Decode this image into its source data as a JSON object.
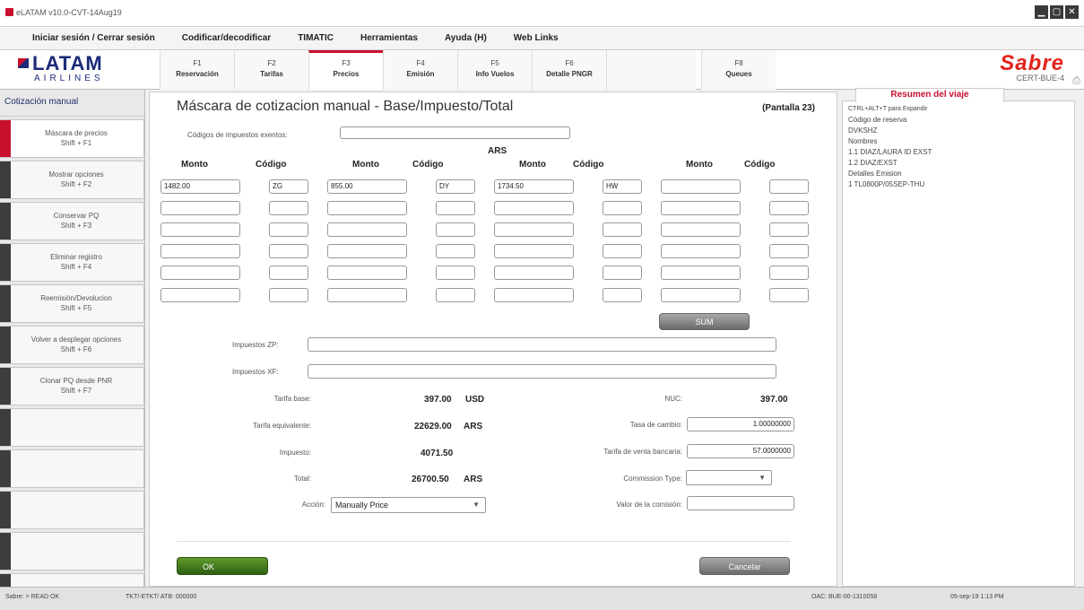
{
  "window": {
    "title": "eLATAM v10.0-CVT-14Aug19"
  },
  "menu": [
    "Iniciar sesión / Cerrar sesión",
    "Codificar/decodificar",
    "TIMATIC",
    "Herramientas",
    "Ayuda (H)",
    "Web Links"
  ],
  "brand": {
    "name": "LATAM",
    "sub": "AIRLINES",
    "sabre": "Sabre",
    "sabre_code": "CERT-BUE-4"
  },
  "fkeys": [
    {
      "key": "F1",
      "name": "Reservación"
    },
    {
      "key": "F2",
      "name": "Tarifas"
    },
    {
      "key": "F3",
      "name": "Precios",
      "active": true
    },
    {
      "key": "F4",
      "name": "Emisión"
    },
    {
      "key": "F5",
      "name": "Info Vuelos"
    },
    {
      "key": "F6",
      "name": "Detalle PNGR"
    },
    {
      "key": "",
      "name": ""
    },
    {
      "key": "F8",
      "name": "Queues"
    }
  ],
  "sidebar": {
    "header": "Cotización manual",
    "items": [
      {
        "label": "Máscara de precios",
        "key": "Shift + F1"
      },
      {
        "label": "Mostrar opciones",
        "key": "Shift + F2"
      },
      {
        "label": "Conservar PQ",
        "key": "Shift + F3"
      },
      {
        "label": "Eliminar registro",
        "key": "Shift + F4"
      },
      {
        "label": "Reemisión/Devolucion",
        "key": "Shift + F5"
      },
      {
        "label": "Volver a desplegar opciones",
        "key": "Shift + F6"
      },
      {
        "label": "Clonar PQ desde PNR",
        "key": "Shift + F7"
      }
    ]
  },
  "main": {
    "title": "Máscara de cotizacion manual - Base/Impuesto/Total",
    "pantalla": "(Pantalla 23)",
    "exempt_label": "Códigos de impuestos exentos:",
    "currency": "ARS",
    "col_monto": "Monto",
    "col_codigo": "Código",
    "tax_rows": [
      [
        {
          "monto": "1482.00",
          "codigo": "ZG"
        },
        {
          "monto": "855.00",
          "codigo": "DY"
        },
        {
          "monto": "1734.50",
          "codigo": "HW"
        },
        {
          "monto": "",
          "codigo": ""
        }
      ],
      [
        {
          "monto": "",
          "codigo": ""
        },
        {
          "monto": "",
          "codigo": ""
        },
        {
          "monto": "",
          "codigo": ""
        },
        {
          "monto": "",
          "codigo": ""
        }
      ],
      [
        {
          "monto": "",
          "codigo": ""
        },
        {
          "monto": "",
          "codigo": ""
        },
        {
          "monto": "",
          "codigo": ""
        },
        {
          "monto": "",
          "codigo": ""
        }
      ],
      [
        {
          "monto": "",
          "codigo": ""
        },
        {
          "monto": "",
          "codigo": ""
        },
        {
          "monto": "",
          "codigo": ""
        },
        {
          "monto": "",
          "codigo": ""
        }
      ],
      [
        {
          "monto": "",
          "codigo": ""
        },
        {
          "monto": "",
          "codigo": ""
        },
        {
          "monto": "",
          "codigo": ""
        },
        {
          "monto": "",
          "codigo": ""
        }
      ],
      [
        {
          "monto": "",
          "codigo": ""
        },
        {
          "monto": "",
          "codigo": ""
        },
        {
          "monto": "",
          "codigo": ""
        },
        {
          "monto": "",
          "codigo": ""
        }
      ]
    ],
    "sum_button": "SUM",
    "zp_label": "Impuestos ZP:",
    "xf_label": "Impuestos XF:",
    "tarifa_base_label": "Tarifa base:",
    "tarifa_base_value": "397.00",
    "tarifa_base_currency": "USD",
    "tarifa_equiv_label": "Tarifa equivalente:",
    "tarifa_equiv_value": "22629.00",
    "tarifa_equiv_currency": "ARS",
    "impuesto_label": "Impuesto:",
    "impuesto_value": "4071.50",
    "total_label": "Total:",
    "total_value": "26700.50",
    "total_currency": "ARS",
    "accion_label": "Acción:",
    "accion_value": "Manually Price",
    "nuc_label": "NUC:",
    "nuc_value": "397.00",
    "tasa_label": "Tasa de cambio:",
    "tasa_value": "1.00000000",
    "tarifa_venta_label": "Tarifa de venta bancaria:",
    "tarifa_venta_value": "57.0000000",
    "commission_type_label": "Commission Type:",
    "commission_type_value": "",
    "valor_comision_label": "Valor de la comisión:",
    "valor_comision_value": "",
    "ok_label": "OK",
    "cancel_label": "Cancelar"
  },
  "resumen": {
    "tab": "Resumen del viaje",
    "lines": [
      "CTRL+ALT+T para Expandir",
      "Código de reserva",
      "DVKSHZ",
      "Nombres",
      "1.1 DIAZ/LAURA ID EXST",
      "1.2 DIAZ/EXST",
      "Detalles Emision",
      "1 TL0800P/05SEP-THU"
    ]
  },
  "status": {
    "left": "Sabre: > READ OK",
    "mid": "TKT/-ETKT/ ATB: 000000",
    "right1": "OAC: BUE-00-1310058",
    "right2": "05-sep-19 1:13 PM"
  }
}
